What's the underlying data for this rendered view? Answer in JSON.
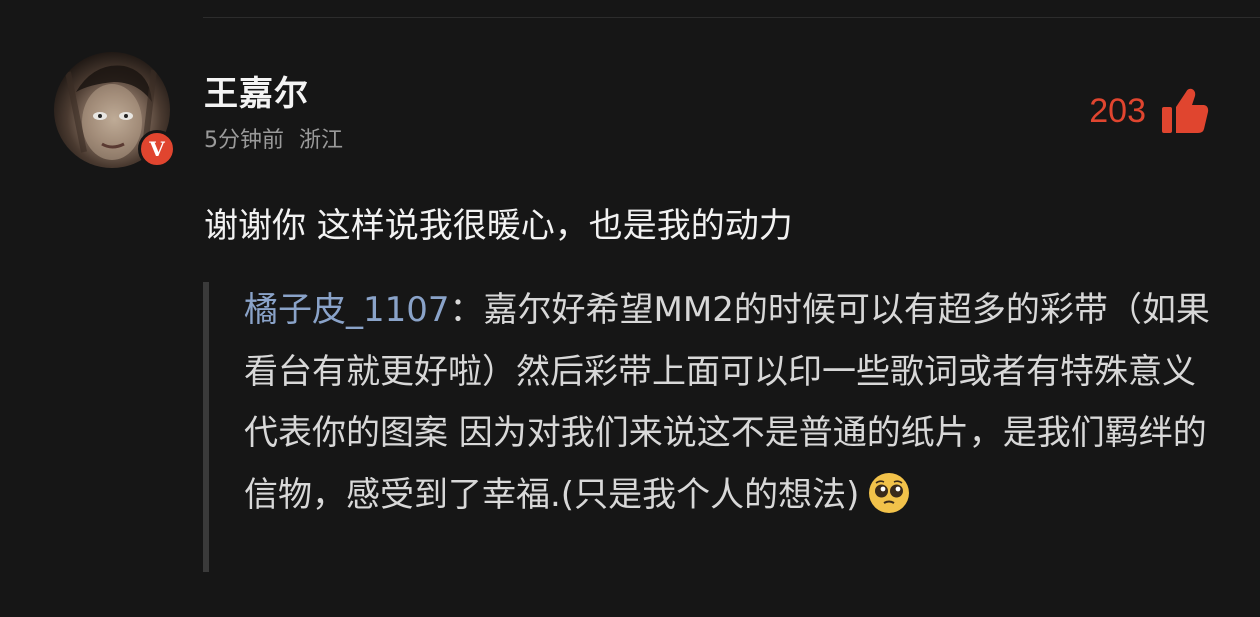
{
  "comment": {
    "user": {
      "name": "王嘉尔",
      "verified_badge": "V"
    },
    "meta": {
      "time": "5分钟前",
      "location": "浙江"
    },
    "likes": {
      "count": "203",
      "icon": "thumbs-up-icon",
      "color": "#e0452f"
    },
    "text": "谢谢你 这样说我很暖心，也是我的动力",
    "quote": {
      "author": "橘子皮_1107",
      "separator": "：",
      "text": "嘉尔好希望MM2的时候可以有超多的彩带（如果看台有就更好啦）然后彩带上面可以印一些歌词或者有特殊意义代表你的图案 因为对我们来说这不是普通的纸片，是我们羁绊的信物，感受到了幸福.(只是我个人的想法)",
      "emoji": "pleading-face-icon"
    }
  },
  "colors": {
    "background": "#161616",
    "accent": "#e0452f",
    "quote_author": "#8aa3c9",
    "meta_text": "#9a9a9a"
  }
}
